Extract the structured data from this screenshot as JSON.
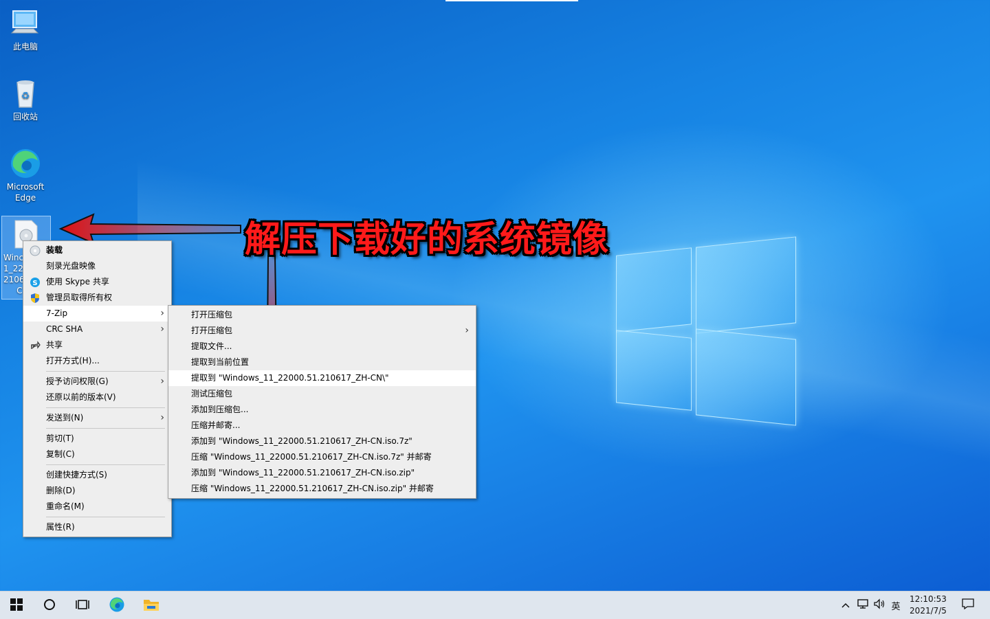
{
  "desktop": {
    "icons": [
      {
        "label": "此电脑"
      },
      {
        "label": "回收站"
      },
      {
        "label": "Microsoft Edge"
      }
    ],
    "selected_file_label": "Winc\n1_220\n2106\n     C"
  },
  "annotation": {
    "text": "解压下载好的系统镜像",
    "color": "#ff1a1a"
  },
  "context_menu": {
    "items": [
      {
        "label": "装载",
        "icon": "disc-icon"
      },
      {
        "label": "刻录光盘映像"
      },
      {
        "label": "使用 Skype 共享",
        "icon": "skype-icon"
      },
      {
        "label": "管理员取得所有权",
        "icon": "uac-shield-icon"
      },
      {
        "label": "7-Zip"
      },
      {
        "label": "CRC SHA"
      },
      {
        "label": "共享",
        "icon": "share-icon"
      },
      {
        "label": "打开方式(H)..."
      },
      {
        "label": "授予访问权限(G)"
      },
      {
        "label": "还原以前的版本(V)"
      },
      {
        "label": "发送到(N)"
      },
      {
        "label": "剪切(T)"
      },
      {
        "label": "复制(C)"
      },
      {
        "label": "创建快捷方式(S)"
      },
      {
        "label": "删除(D)"
      },
      {
        "label": "重命名(M)"
      },
      {
        "label": "属性(R)"
      }
    ]
  },
  "zip_submenu": {
    "items": [
      {
        "label": "打开压缩包"
      },
      {
        "label": "打开压缩包"
      },
      {
        "label": "提取文件..."
      },
      {
        "label": "提取到当前位置"
      },
      {
        "label": "提取到 \"Windows_11_22000.51.210617_ZH-CN\\\""
      },
      {
        "label": "测试压缩包"
      },
      {
        "label": "添加到压缩包..."
      },
      {
        "label": "压缩并邮寄..."
      },
      {
        "label": "添加到 \"Windows_11_22000.51.210617_ZH-CN.iso.7z\""
      },
      {
        "label": "压缩 \"Windows_11_22000.51.210617_ZH-CN.iso.7z\" 并邮寄"
      },
      {
        "label": "添加到 \"Windows_11_22000.51.210617_ZH-CN.iso.zip\""
      },
      {
        "label": "压缩 \"Windows_11_22000.51.210617_ZH-CN.iso.zip\" 并邮寄"
      }
    ]
  },
  "taskbar": {
    "input_method": "英",
    "time": "12:10:53",
    "date": "2021/7/5"
  },
  "colors": {
    "menu_bg": "#eeeeee",
    "menu_highlight": "#ffffff",
    "taskbar_bg": "#dfe6ee"
  }
}
